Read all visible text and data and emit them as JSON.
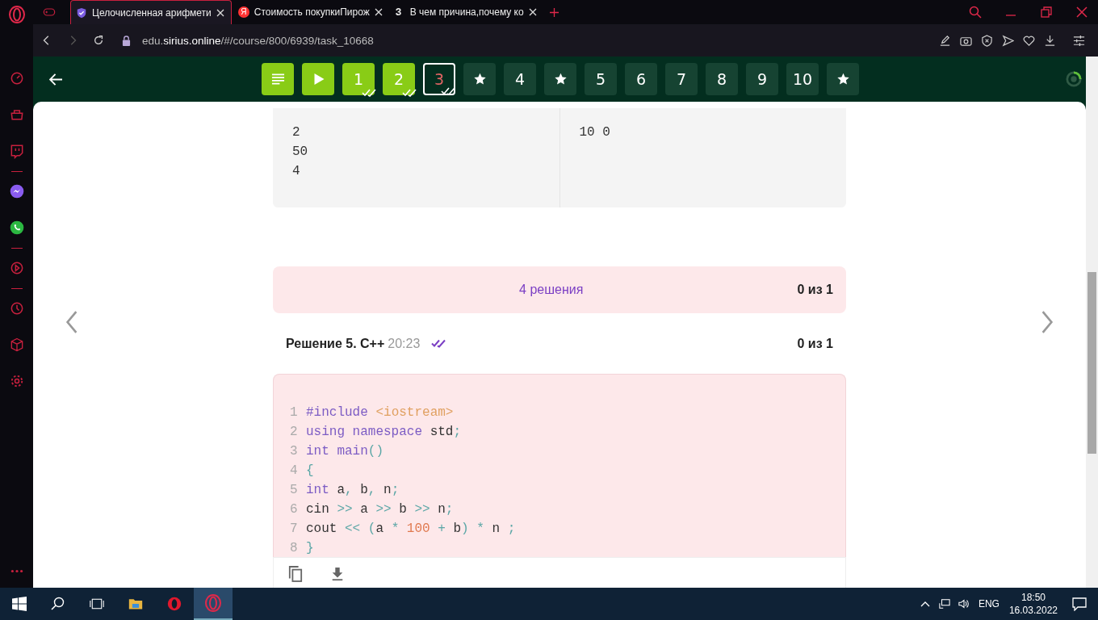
{
  "browser_tabs": [
    {
      "title": "Целочисленная арифмети",
      "selected": true
    },
    {
      "title": "Стоимость покупкиПирож",
      "icon_text": "Я",
      "selected": false
    },
    {
      "title": "В чем причина,почему ко",
      "icon_text": "З",
      "selected": false
    }
  ],
  "address_bar": {
    "host_prefix": "edu.",
    "host": "sirius.online",
    "path": "/#/course/800/6939/task_10668"
  },
  "task_nav": [
    {
      "kind": "list",
      "solved": true,
      "selected": false,
      "reviewed": false
    },
    {
      "kind": "play",
      "solved": true,
      "selected": false,
      "reviewed": false
    },
    {
      "kind": "number",
      "label": "1",
      "solved": true,
      "selected": false,
      "reviewed": true
    },
    {
      "kind": "number",
      "label": "2",
      "solved": true,
      "selected": false,
      "reviewed": true
    },
    {
      "kind": "number",
      "label": "3",
      "solved": false,
      "selected": true,
      "reviewed": true
    },
    {
      "kind": "star",
      "solved": false,
      "selected": false,
      "reviewed": false
    },
    {
      "kind": "number",
      "label": "4",
      "solved": false,
      "selected": false,
      "reviewed": false
    },
    {
      "kind": "star",
      "solved": false,
      "selected": false,
      "reviewed": false
    },
    {
      "kind": "number",
      "label": "5",
      "solved": false,
      "selected": false,
      "reviewed": false
    },
    {
      "kind": "number",
      "label": "6",
      "solved": false,
      "selected": false,
      "reviewed": false
    },
    {
      "kind": "number",
      "label": "7",
      "solved": false,
      "selected": false,
      "reviewed": false
    },
    {
      "kind": "number",
      "label": "8",
      "solved": false,
      "selected": false,
      "reviewed": false
    },
    {
      "kind": "number",
      "label": "9",
      "solved": false,
      "selected": false,
      "reviewed": false
    },
    {
      "kind": "number",
      "label": "10",
      "solved": false,
      "selected": false,
      "reviewed": false
    },
    {
      "kind": "star",
      "solved": false,
      "selected": false,
      "reviewed": false
    }
  ],
  "example_table": {
    "input": [
      "2",
      "50",
      "4"
    ],
    "output": [
      "10 0"
    ]
  },
  "solutions_bar": {
    "label": "4 решения",
    "score": "0 из 1"
  },
  "solution": {
    "title": "Решение 5. C++",
    "time": "20:23",
    "checked": true,
    "score": "0 из 1",
    "lines": [
      {
        "number": "1",
        "tokens": [
          {
            "text": "#include ",
            "kind": "keyword"
          },
          {
            "text": "<iostream>",
            "kind": "string"
          }
        ]
      },
      {
        "number": "2",
        "tokens": [
          {
            "text": "using namespace ",
            "kind": "keyword"
          },
          {
            "text": "std",
            "kind": "plain"
          },
          {
            "text": ";",
            "kind": "punct"
          }
        ]
      },
      {
        "number": "3",
        "tokens": [
          {
            "text": "int main",
            "kind": "keyword"
          },
          {
            "text": "()",
            "kind": "punct"
          }
        ]
      },
      {
        "number": "4",
        "tokens": [
          {
            "text": "{",
            "kind": "punct"
          }
        ]
      },
      {
        "number": "5",
        "tokens": [
          {
            "text": "int ",
            "kind": "keyword"
          },
          {
            "text": "a",
            "kind": "plain"
          },
          {
            "text": ", ",
            "kind": "punct"
          },
          {
            "text": "b",
            "kind": "plain"
          },
          {
            "text": ", ",
            "kind": "punct"
          },
          {
            "text": "n",
            "kind": "plain"
          },
          {
            "text": ";",
            "kind": "punct"
          }
        ]
      },
      {
        "number": "6",
        "tokens": [
          {
            "text": "cin ",
            "kind": "plain"
          },
          {
            "text": ">> ",
            "kind": "punct"
          },
          {
            "text": "a ",
            "kind": "plain"
          },
          {
            "text": ">> ",
            "kind": "punct"
          },
          {
            "text": "b ",
            "kind": "plain"
          },
          {
            "text": ">> ",
            "kind": "punct"
          },
          {
            "text": "n",
            "kind": "plain"
          },
          {
            "text": ";",
            "kind": "punct"
          }
        ]
      },
      {
        "number": "7",
        "tokens": [
          {
            "text": "cout ",
            "kind": "plain"
          },
          {
            "text": "<< (",
            "kind": "punct"
          },
          {
            "text": "a ",
            "kind": "plain"
          },
          {
            "text": "* ",
            "kind": "punct"
          },
          {
            "text": "100 ",
            "kind": "number"
          },
          {
            "text": "+ ",
            "kind": "punct"
          },
          {
            "text": "b",
            "kind": "plain"
          },
          {
            "text": ") * ",
            "kind": "punct"
          },
          {
            "text": "n ",
            "kind": "plain"
          },
          {
            "text": ";",
            "kind": "punct"
          }
        ]
      },
      {
        "number": "8",
        "tokens": [
          {
            "text": "}",
            "kind": "punct"
          }
        ]
      }
    ]
  },
  "taskbar": {
    "language": "ENG",
    "time": "18:50",
    "date": "16.03.2022"
  }
}
